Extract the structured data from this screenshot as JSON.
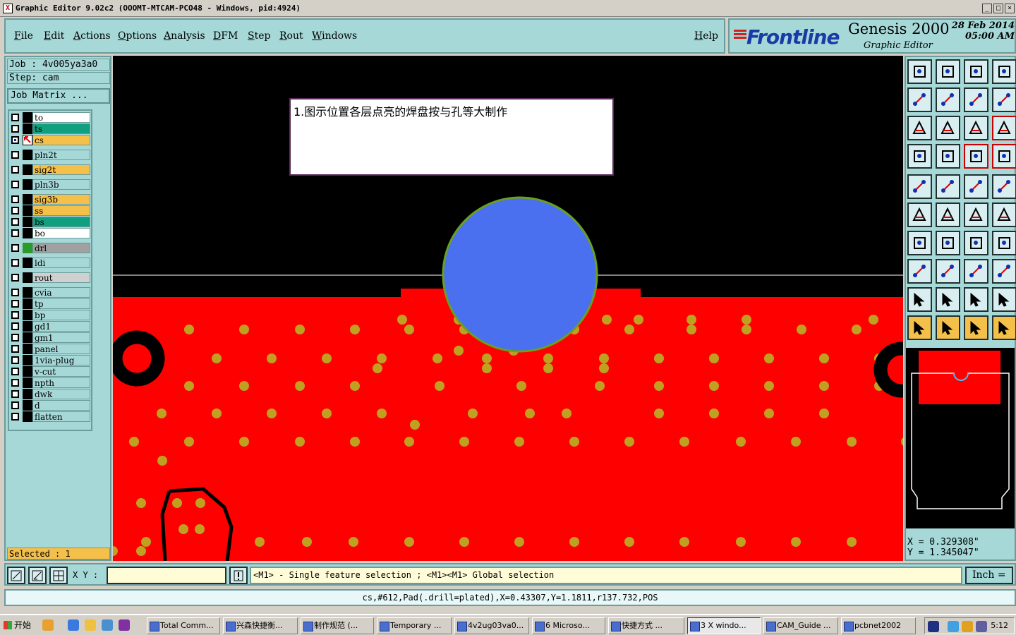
{
  "window": {
    "title": "Graphic Editor 9.02c2 (OOOMT-MTCAM-PCO48 - Windows, pid:4924)",
    "controls": [
      "_",
      "□",
      "×"
    ]
  },
  "menu": {
    "items": [
      "File",
      "Edit",
      "Actions",
      "Options",
      "Analysis",
      "DFM",
      "Step",
      "Rout",
      "Windows"
    ],
    "help": "Help"
  },
  "brand": {
    "logo": "Frontline",
    "product": "Genesis 2000",
    "subtitle": "Graphic Editor",
    "date": "28 Feb 2014",
    "time": "05:00 AM"
  },
  "job": {
    "job_label": "Job : 4v005ya3a0",
    "step_label": "Step: cam",
    "matrix_button": "Job Matrix ..."
  },
  "layers": [
    {
      "name": "to",
      "color": "#ffffff"
    },
    {
      "name": "ts",
      "color": "#10a080"
    },
    {
      "name": "cs",
      "color": "#f5c04a",
      "active": true
    },
    {
      "name": "pln2t",
      "color": "#a6d8d8"
    },
    {
      "name": "sig2t",
      "color": "#f5c04a"
    },
    {
      "name": "pln3b",
      "color": "#a6d8d8"
    },
    {
      "name": "sig3b",
      "color": "#f5c04a"
    },
    {
      "name": "ss",
      "color": "#f5c04a"
    },
    {
      "name": "bs",
      "color": "#10a080"
    },
    {
      "name": "bo",
      "color": "#ffffff"
    },
    {
      "name": "drl",
      "color": "#a0a0a0"
    },
    {
      "name": "ldi",
      "color": "#a6d8d8"
    },
    {
      "name": "rout",
      "color": "#d0d0d0"
    },
    {
      "name": "cvia",
      "color": "#a6d8d8"
    },
    {
      "name": "tp",
      "color": "#a6d8d8"
    },
    {
      "name": "bp",
      "color": "#a6d8d8"
    },
    {
      "name": "gd1",
      "color": "#a6d8d8"
    },
    {
      "name": "gm1",
      "color": "#a6d8d8"
    },
    {
      "name": "panel",
      "color": "#a6d8d8"
    },
    {
      "name": "1via-plug",
      "color": "#a6d8d8"
    },
    {
      "name": "v-cut",
      "color": "#a6d8d8"
    },
    {
      "name": "npth",
      "color": "#a6d8d8"
    },
    {
      "name": "dwk",
      "color": "#a6d8d8"
    },
    {
      "name": "d",
      "color": "#a6d8d8"
    },
    {
      "name": "flatten",
      "color": "#a6d8d8"
    }
  ],
  "selected": "Selected : 1",
  "canvas": {
    "note": "1.图示位置各层点亮的焊盘按与孔等大制作"
  },
  "coords": {
    "x": "X = 0.329308\"",
    "y": "Y = 1.345047\""
  },
  "command": {
    "xy_label": "X Y :",
    "xy_value": "",
    "message": "<M1> - Single feature selection ; <M1><M1> Global selection",
    "unit": "Inch ="
  },
  "status": "cs,#612,Pad(.drill=plated),X=0.43307,Y=1.1811,r137.732,POS",
  "taskbar": {
    "start": "开始",
    "tasks": [
      "Total Comm...",
      "兴森快捷衡...",
      "制作规范 (...",
      "Temporary ...",
      "4v2ug03va0...",
      "6 Microso...",
      "快捷方式 ...",
      "3 X windo...",
      "CAM_Guide ...",
      "pcbnet2002"
    ],
    "clock": "5:12"
  }
}
